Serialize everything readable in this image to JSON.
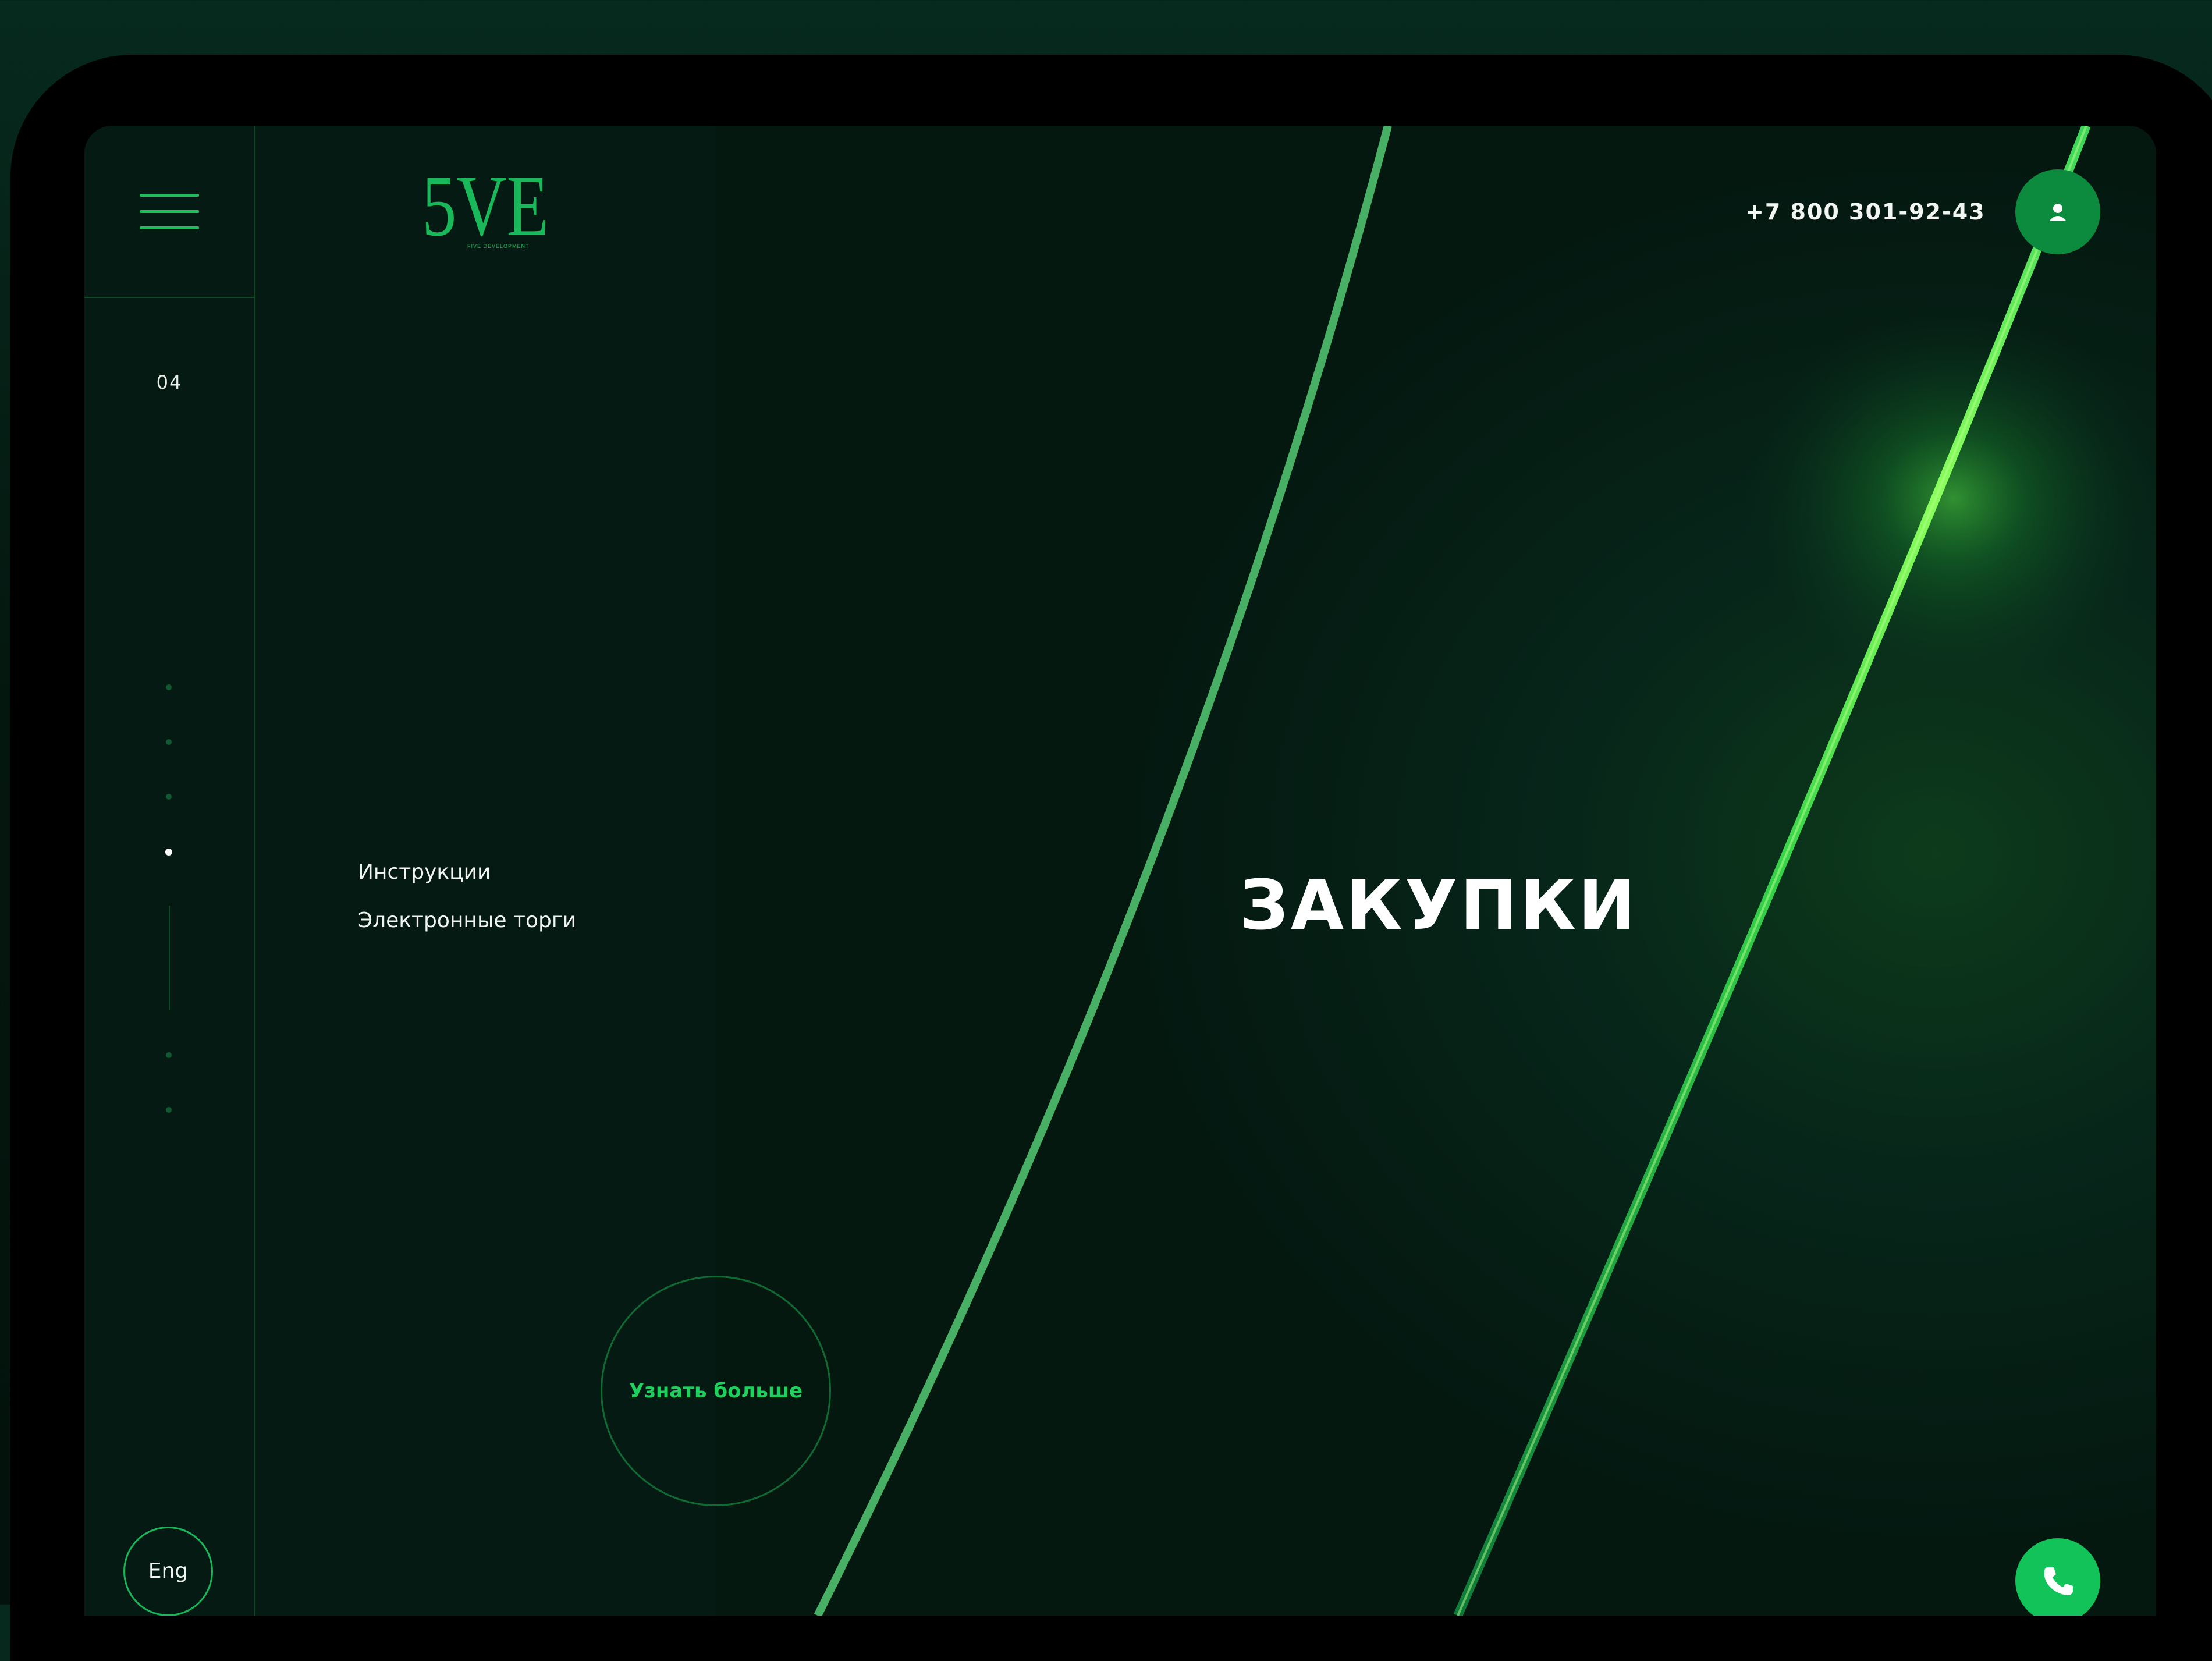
{
  "header": {
    "logo_text": "5VE",
    "logo_subtitle": "FIVE DEVELOPMENT",
    "phone": "+7 800 301-92-43"
  },
  "sidebar": {
    "slide_number": "04",
    "lang_button": "Eng"
  },
  "section": {
    "title": "ЗАКУПКИ",
    "links": [
      "Инструкции",
      "Электронные торги"
    ],
    "more_button": "Узнать больше"
  },
  "icons": {
    "menu": "hamburger-menu-icon",
    "user": "user-icon",
    "call": "phone-icon"
  },
  "colors": {
    "accent": "#19c05a",
    "background": "#061a14",
    "text": "#ffffff"
  }
}
